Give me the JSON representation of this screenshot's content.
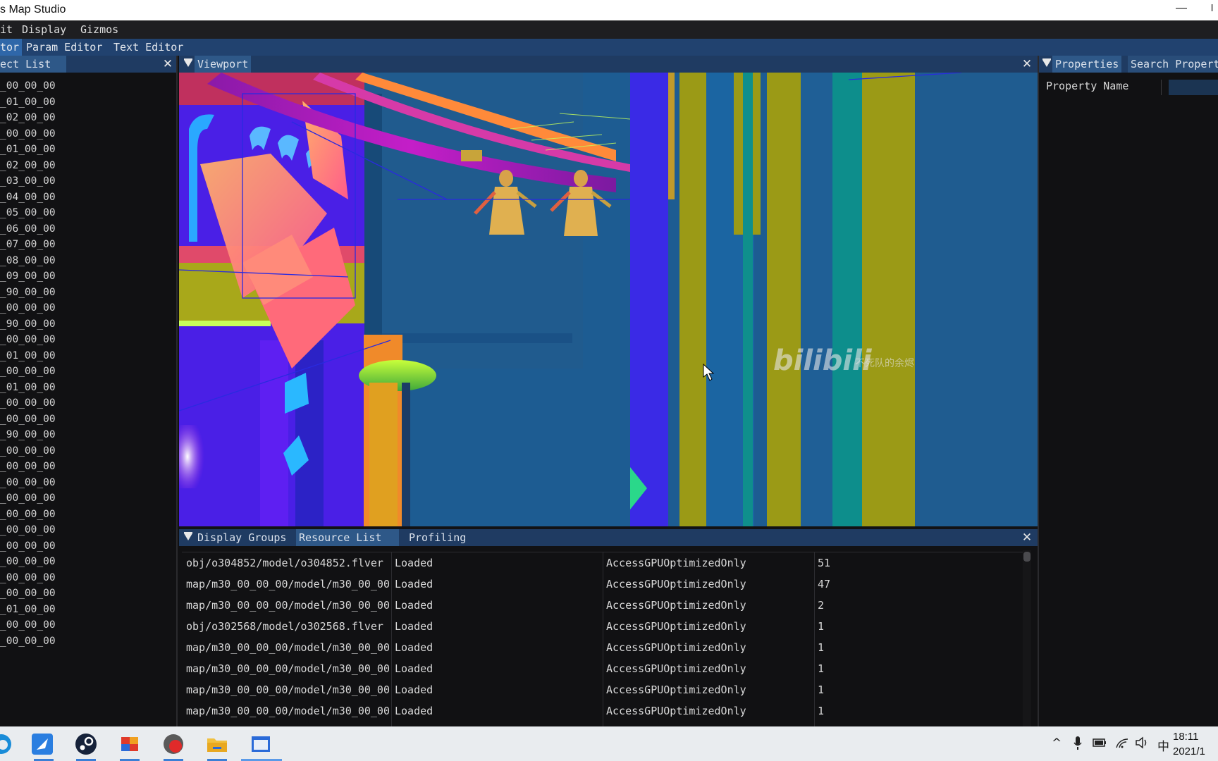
{
  "window": {
    "title": "s Map Studio",
    "minimize_glyph": "—",
    "maximize_glyph": "l"
  },
  "menubar": {
    "items": [
      "it",
      "Display",
      "Gizmos"
    ]
  },
  "editor_tabs": {
    "items": [
      "tor",
      "Param Editor",
      "Text Editor"
    ],
    "active_index": 0
  },
  "object_list": {
    "title": "ect List",
    "close_glyph": "✕",
    "items": [
      "_00_00_00",
      "_01_00_00",
      "_02_00_00",
      "_00_00_00",
      "_01_00_00",
      "_02_00_00",
      "_03_00_00",
      "_04_00_00",
      "_05_00_00",
      "_06_00_00",
      "_07_00_00",
      "_08_00_00",
      "_09_00_00",
      "_90_00_00",
      "_00_00_00",
      "_90_00_00",
      "_00_00_00",
      "_01_00_00",
      "_00_00_00",
      "_01_00_00",
      "_00_00_00",
      "_00_00_00",
      "_90_00_00",
      "_00_00_00",
      "_00_00_00",
      "_00_00_00",
      "_00_00_00",
      "_00_00_00",
      "_00_00_00",
      "_00_00_00",
      "_00_00_00",
      "_00_00_00",
      "_00_00_00",
      "_01_00_00",
      "_00_00_00",
      "_00_00_00"
    ]
  },
  "viewport": {
    "title": "Viewport",
    "close_glyph": "✕",
    "watermark": "bilibili",
    "watermark_sub": "不死队的余烬"
  },
  "properties": {
    "tabs": [
      "Properties",
      "Search Propert"
    ],
    "field_label": "Property Name",
    "field_value": ""
  },
  "resource_panel": {
    "tabs": [
      "Display Groups",
      "Resource List",
      "Profiling"
    ],
    "active_index": 1,
    "close_glyph": "✕",
    "rows": [
      {
        "path": "obj/o304852/model/o304852.flver",
        "status": "Loaded",
        "access": "AccessGPUOptimizedOnly",
        "refs": "51"
      },
      {
        "path": "map/m30_00_00_00/model/m30_00_00",
        "status": "Loaded",
        "access": "AccessGPUOptimizedOnly",
        "refs": "47"
      },
      {
        "path": "map/m30_00_00_00/model/m30_00_00",
        "status": "Loaded",
        "access": "AccessGPUOptimizedOnly",
        "refs": "2"
      },
      {
        "path": "obj/o302568/model/o302568.flver",
        "status": "Loaded",
        "access": "AccessGPUOptimizedOnly",
        "refs": "1"
      },
      {
        "path": "map/m30_00_00_00/model/m30_00_00",
        "status": "Loaded",
        "access": "AccessGPUOptimizedOnly",
        "refs": "1"
      },
      {
        "path": "map/m30_00_00_00/model/m30_00_00",
        "status": "Loaded",
        "access": "AccessGPUOptimizedOnly",
        "refs": "1"
      },
      {
        "path": "map/m30_00_00_00/model/m30_00_00",
        "status": "Loaded",
        "access": "AccessGPUOptimizedOnly",
        "refs": "1"
      },
      {
        "path": "map/m30_00_00_00/model/m30_00_00",
        "status": "Loaded",
        "access": "AccessGPUOptimizedOnly",
        "refs": "1"
      }
    ]
  },
  "taskbar": {
    "apps": [
      "edge-icon",
      "feather-app-icon",
      "steam-icon",
      "office-icon",
      "recorder-icon",
      "file-explorer-icon",
      "map-studio-icon"
    ],
    "tray": {
      "chevron": "^",
      "ime": "中"
    },
    "clock_time": "18:11",
    "clock_date": "2021/1"
  },
  "colors": {
    "accent": "#2f67a9",
    "panel_header": "#1f3b62",
    "scene_blue": "#1d5c92",
    "olive": "#9b9a16",
    "teal": "#0d8e8c",
    "purple": "#5a1fe0"
  }
}
